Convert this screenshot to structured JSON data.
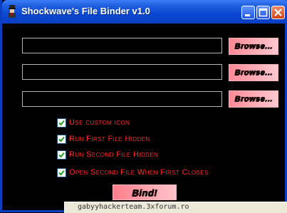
{
  "window": {
    "title": "Shockwave's File Binder v1.0"
  },
  "fields": [
    {
      "value": "",
      "browse_label": "Browse..."
    },
    {
      "value": "",
      "browse_label": "Browse..."
    },
    {
      "value": "",
      "browse_label": "Browse..."
    }
  ],
  "options": [
    {
      "label": "Use custom icon",
      "checked": true
    },
    {
      "label": "Run First File Hidden",
      "checked": true
    },
    {
      "label": "Run Second File Hidden",
      "checked": true
    },
    {
      "label": "Open Second File When First Closes",
      "checked": true
    }
  ],
  "bind_label": "Bind!",
  "status_text": "gabyyhackerteam.3xforum.ro",
  "colors": {
    "title_bar": "#0a47d2",
    "button_pink": "#ff8a96",
    "option_text": "#ff2a2a",
    "background": "#000000"
  }
}
